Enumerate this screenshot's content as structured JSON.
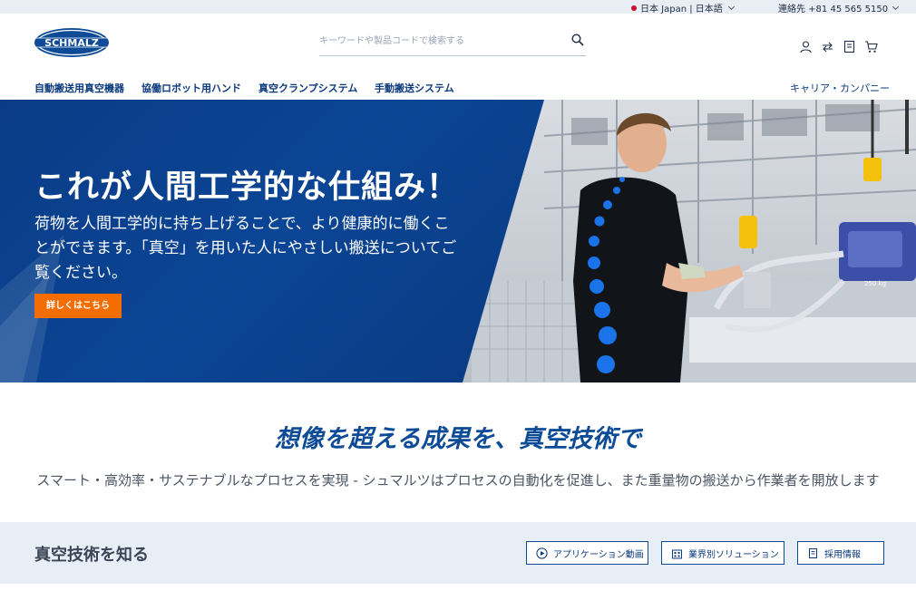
{
  "topbar": {
    "language": "日本 Japan | 日本語",
    "contact": "連絡先 +81 45 565 5150"
  },
  "header": {
    "logo_text": "SCHMALZ",
    "search_placeholder": "キーワードや製品コードで検索する"
  },
  "nav": {
    "items": [
      {
        "label": "自動搬送用真空機器"
      },
      {
        "label": "協働ロボット用ハンド"
      },
      {
        "label": "真空クランプシステム"
      },
      {
        "label": "手動搬送システム"
      }
    ],
    "right_link": "キャリア・カンパニー"
  },
  "hero": {
    "title": "これが人間工学的な仕組み！",
    "body": "荷物を人間工学的に持ち上げることで、より健康的に働くことができます。「真空」を用いた人にやさしい搬送についてご覧ください。",
    "cta": "詳しくはこちら",
    "device_label": "250 kg"
  },
  "tagline": "想像を超える成果を、真空技術で",
  "subtext": "スマート・高効率・サステナブルなプロセスを実現 - シュマルツはプロセスの自動化を促進し、また重量物の搬送から作業者を開放します",
  "band": {
    "title": "真空技術を知る",
    "buttons": [
      {
        "label": "アプリケーション動画",
        "icon": "play-circle-icon"
      },
      {
        "label": "業界別ソリューション",
        "icon": "building-icon"
      },
      {
        "label": "採用情報",
        "icon": "document-icon"
      }
    ]
  },
  "colors": {
    "brand_blue": "#0b3d85",
    "cta_orange": "#f36d00",
    "band_bg": "#e8eef6",
    "topbar_bg": "#e9eef5"
  }
}
